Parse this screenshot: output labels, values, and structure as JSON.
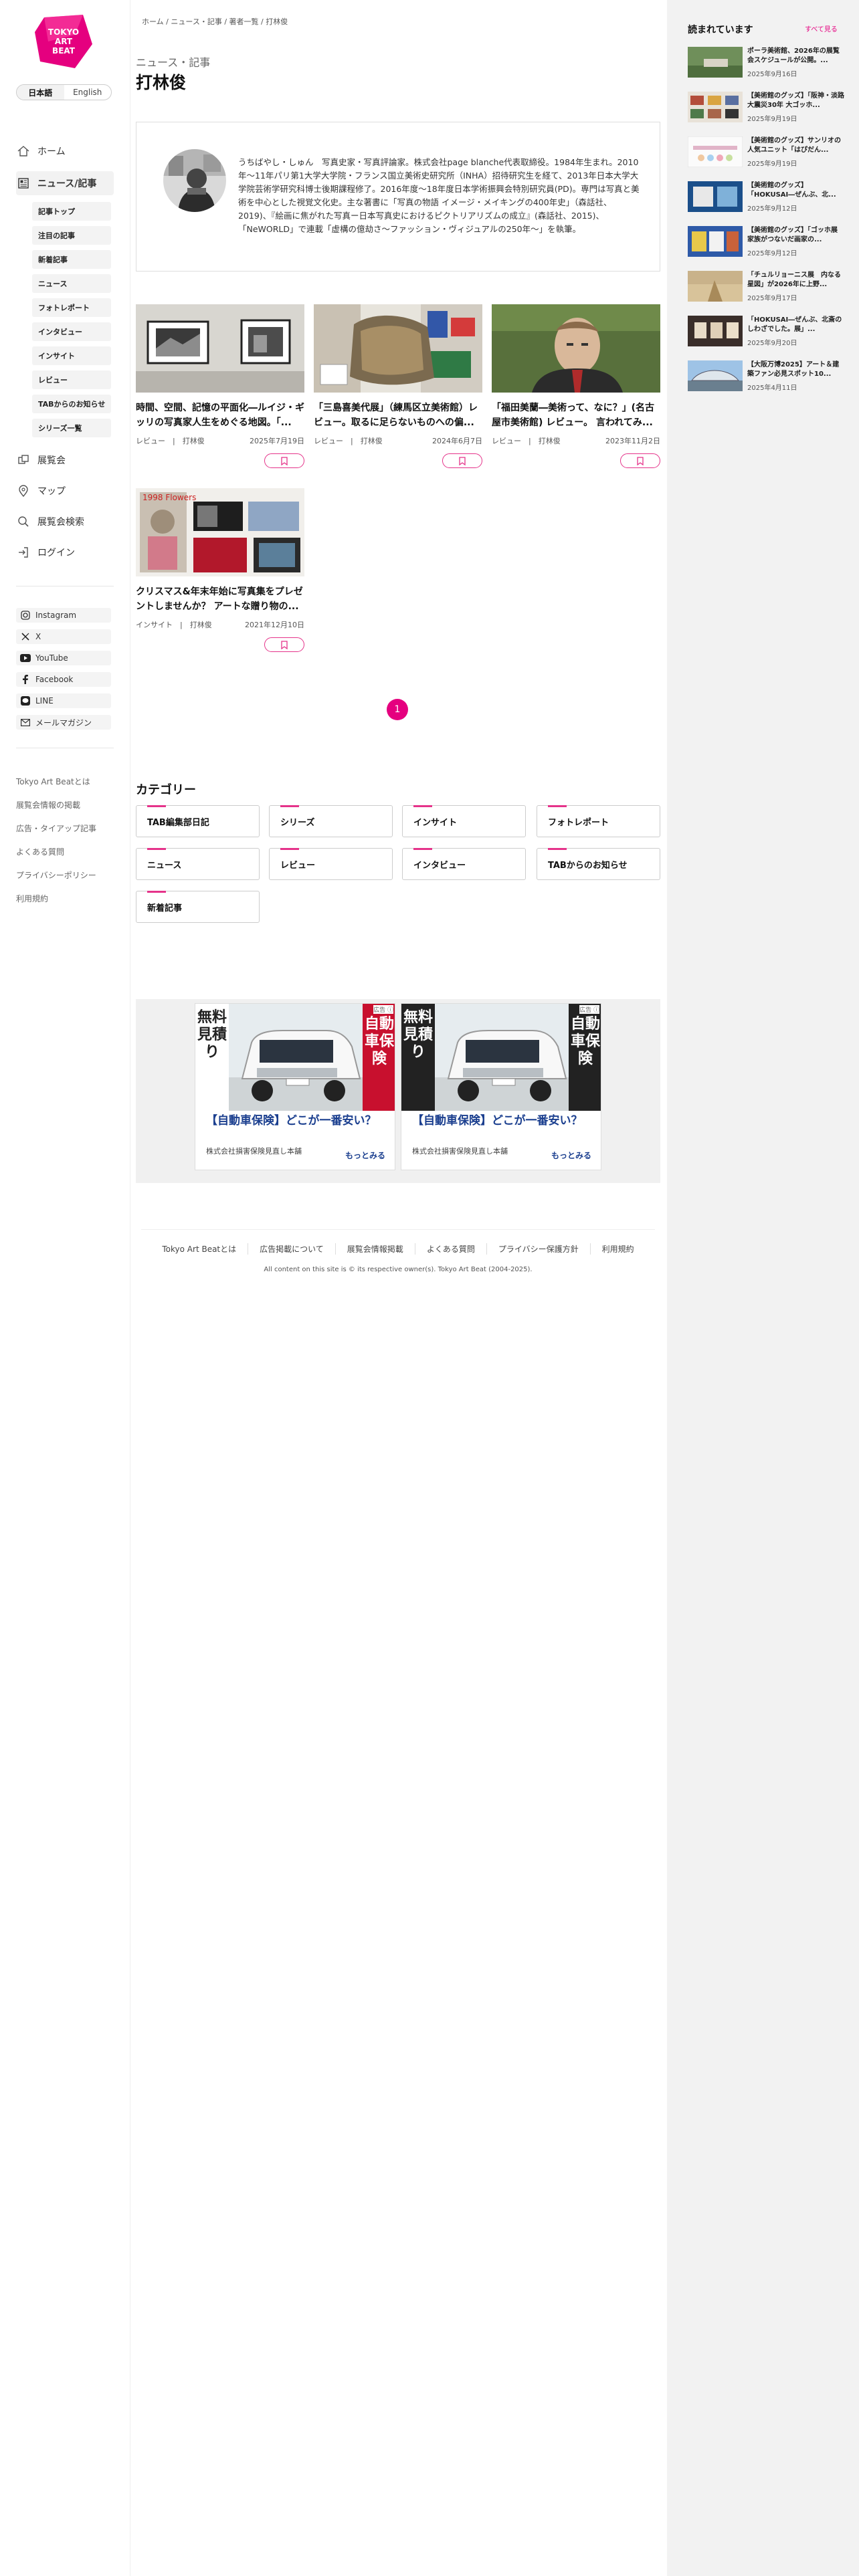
{
  "logo": {
    "lines": [
      "TOKYO",
      "ART",
      "BEAT"
    ],
    "color": "#e5007f"
  },
  "lang": {
    "ja": "日本語",
    "en": "English"
  },
  "nav": {
    "home": "ホーム",
    "news": "ニュース/記事",
    "news_sub": [
      "記事トップ",
      "注目の記事",
      "新着記事",
      "ニュース",
      "フォトレポート",
      "インタビュー",
      "インサイト",
      "レビュー",
      "TABからのお知らせ",
      "シリーズ一覧"
    ],
    "exhibitions": "展覧会",
    "map": "マップ",
    "search": "展覧会検索",
    "login": "ログイン"
  },
  "social": [
    "Instagram",
    "X",
    "YouTube",
    "Facebook",
    "LINE",
    "メールマガジン"
  ],
  "sidebar_footer": [
    "Tokyo Art Beatとは",
    "展覧会情報の掲載",
    "広告・タイアップ記事",
    "よくある質問",
    "プライバシーポリシー",
    "利用規約"
  ],
  "breadcrumb": "ホーム / ニュース・記事 / 著者一覧 / 打林俊",
  "section_label": "ニュース・記事",
  "page_title": "打林俊",
  "profile": {
    "bio": "うちばやし・しゅん　写真史家・写真評論家。株式会社page blanche代表取締役。1984年生まれ。2010年〜11年パリ第1大学大学院・フランス国立美術史研究所（INHA）招待研究生を経て、2013年日本大学大学院芸術学研究科博士後期課程修了。2016年度〜18年度日本学術振興会特別研究員(PD)。専門は写真と美術を中心とした視覚文化史。主な著書に「写真の物語 イメージ・メイキングの400年史」（森話社、2019)、『絵画に焦がれた写真ー日本写真史におけるピクトリアリズムの成立』(森話社、2015)、「NeWORLD」で連載「虚構の億劫さ〜ファッション・ヴィジュアルの250年〜」を執筆。"
  },
  "articles": [
    {
      "title": "時間、空間、記憶の平面化―ルイジ・ギッリの写真家人生をめぐる地図。「...",
      "category": "レビュー",
      "author": "打林俊",
      "date": "2025年7月19日"
    },
    {
      "title": "「三島喜美代展」（練馬区立美術館）レビュー。取るに足らないものへの偏...",
      "category": "レビュー",
      "author": "打林俊",
      "date": "2024年6月7日"
    },
    {
      "title": "「福田美蘭―美術って、なに？」(名古屋市美術館) レビュー。 言われてみ...",
      "category": "レビュー",
      "author": "打林俊",
      "date": "2023年11月2日"
    },
    {
      "title": "クリスマス&年末年始に写真集をプレゼントしませんか？ アートな贈り物の...",
      "category": "インサイト",
      "author": "打林俊",
      "date": "2021年12月10日"
    }
  ],
  "thumb4_text": "1998 Flowers",
  "pagination": {
    "current": "1"
  },
  "categories": {
    "heading": "カテゴリー",
    "items": [
      "TAB編集部日記",
      "シリーズ",
      "インサイト",
      "フォトレポート",
      "ニュース",
      "レビュー",
      "インタビュー",
      "TABからのお知らせ",
      "新着記事"
    ]
  },
  "ads": [
    {
      "badge": "広告 ⓘ",
      "left_v": "無料見積り",
      "right_v": "自動車保険",
      "headline": "【自動車保険】どこが一番安い？",
      "advertiser": "株式会社損害保険見直し本舗",
      "more": "もっとみる"
    },
    {
      "badge": "広告 ⓘ",
      "left_v": "無料見積り",
      "right_v": "自動車保険",
      "headline": "【自動車保険】どこが一番安い？",
      "advertiser": "株式会社損害保険見直し本舗",
      "more": "もっとみる"
    }
  ],
  "footer": {
    "links": [
      "Tokyo Art Beatとは",
      "広告掲載について",
      "展覧会情報掲載",
      "よくある質問",
      "プライバシー保護方針",
      "利用規約"
    ],
    "copyright": "All content on this site is © its respective owner(s). Tokyo Art Beat (2004-2025)."
  },
  "popular": {
    "heading": "読まれています",
    "see_all": "すべて見る",
    "items": [
      {
        "title": "ポーラ美術館、2026年の展覧会スケジュールが公開。...",
        "date": "2025年9月16日"
      },
      {
        "title": "【美術館のグッズ】「阪神・淡路大震災30年 大ゴッホ...",
        "date": "2025年9月19日"
      },
      {
        "title": "【美術館のグッズ】サンリオの人気ユニット「はぴだん...",
        "date": "2025年9月19日"
      },
      {
        "title": "【美術館のグッズ】「HOKUSAI―ぜんぶ、北...",
        "date": "2025年9月12日"
      },
      {
        "title": "【美術館のグッズ】「ゴッホ展　家族がつないだ画家の...",
        "date": "2025年9月12日"
      },
      {
        "title": "「チュルリョーニス展　内なる星図」が2026年に上野...",
        "date": "2025年9月17日"
      },
      {
        "title": "「HOKUSAI―ぜんぶ、北斎のしわざでした。展」...",
        "date": "2025年9月20日"
      },
      {
        "title": "【大阪万博2025】アート＆建築ファン必見スポット10...",
        "date": "2025年4月11日"
      }
    ]
  },
  "colors": {
    "accent": "#e5007f",
    "ad_red": "#c8102e",
    "ad_blue": "#1b3f8f"
  }
}
